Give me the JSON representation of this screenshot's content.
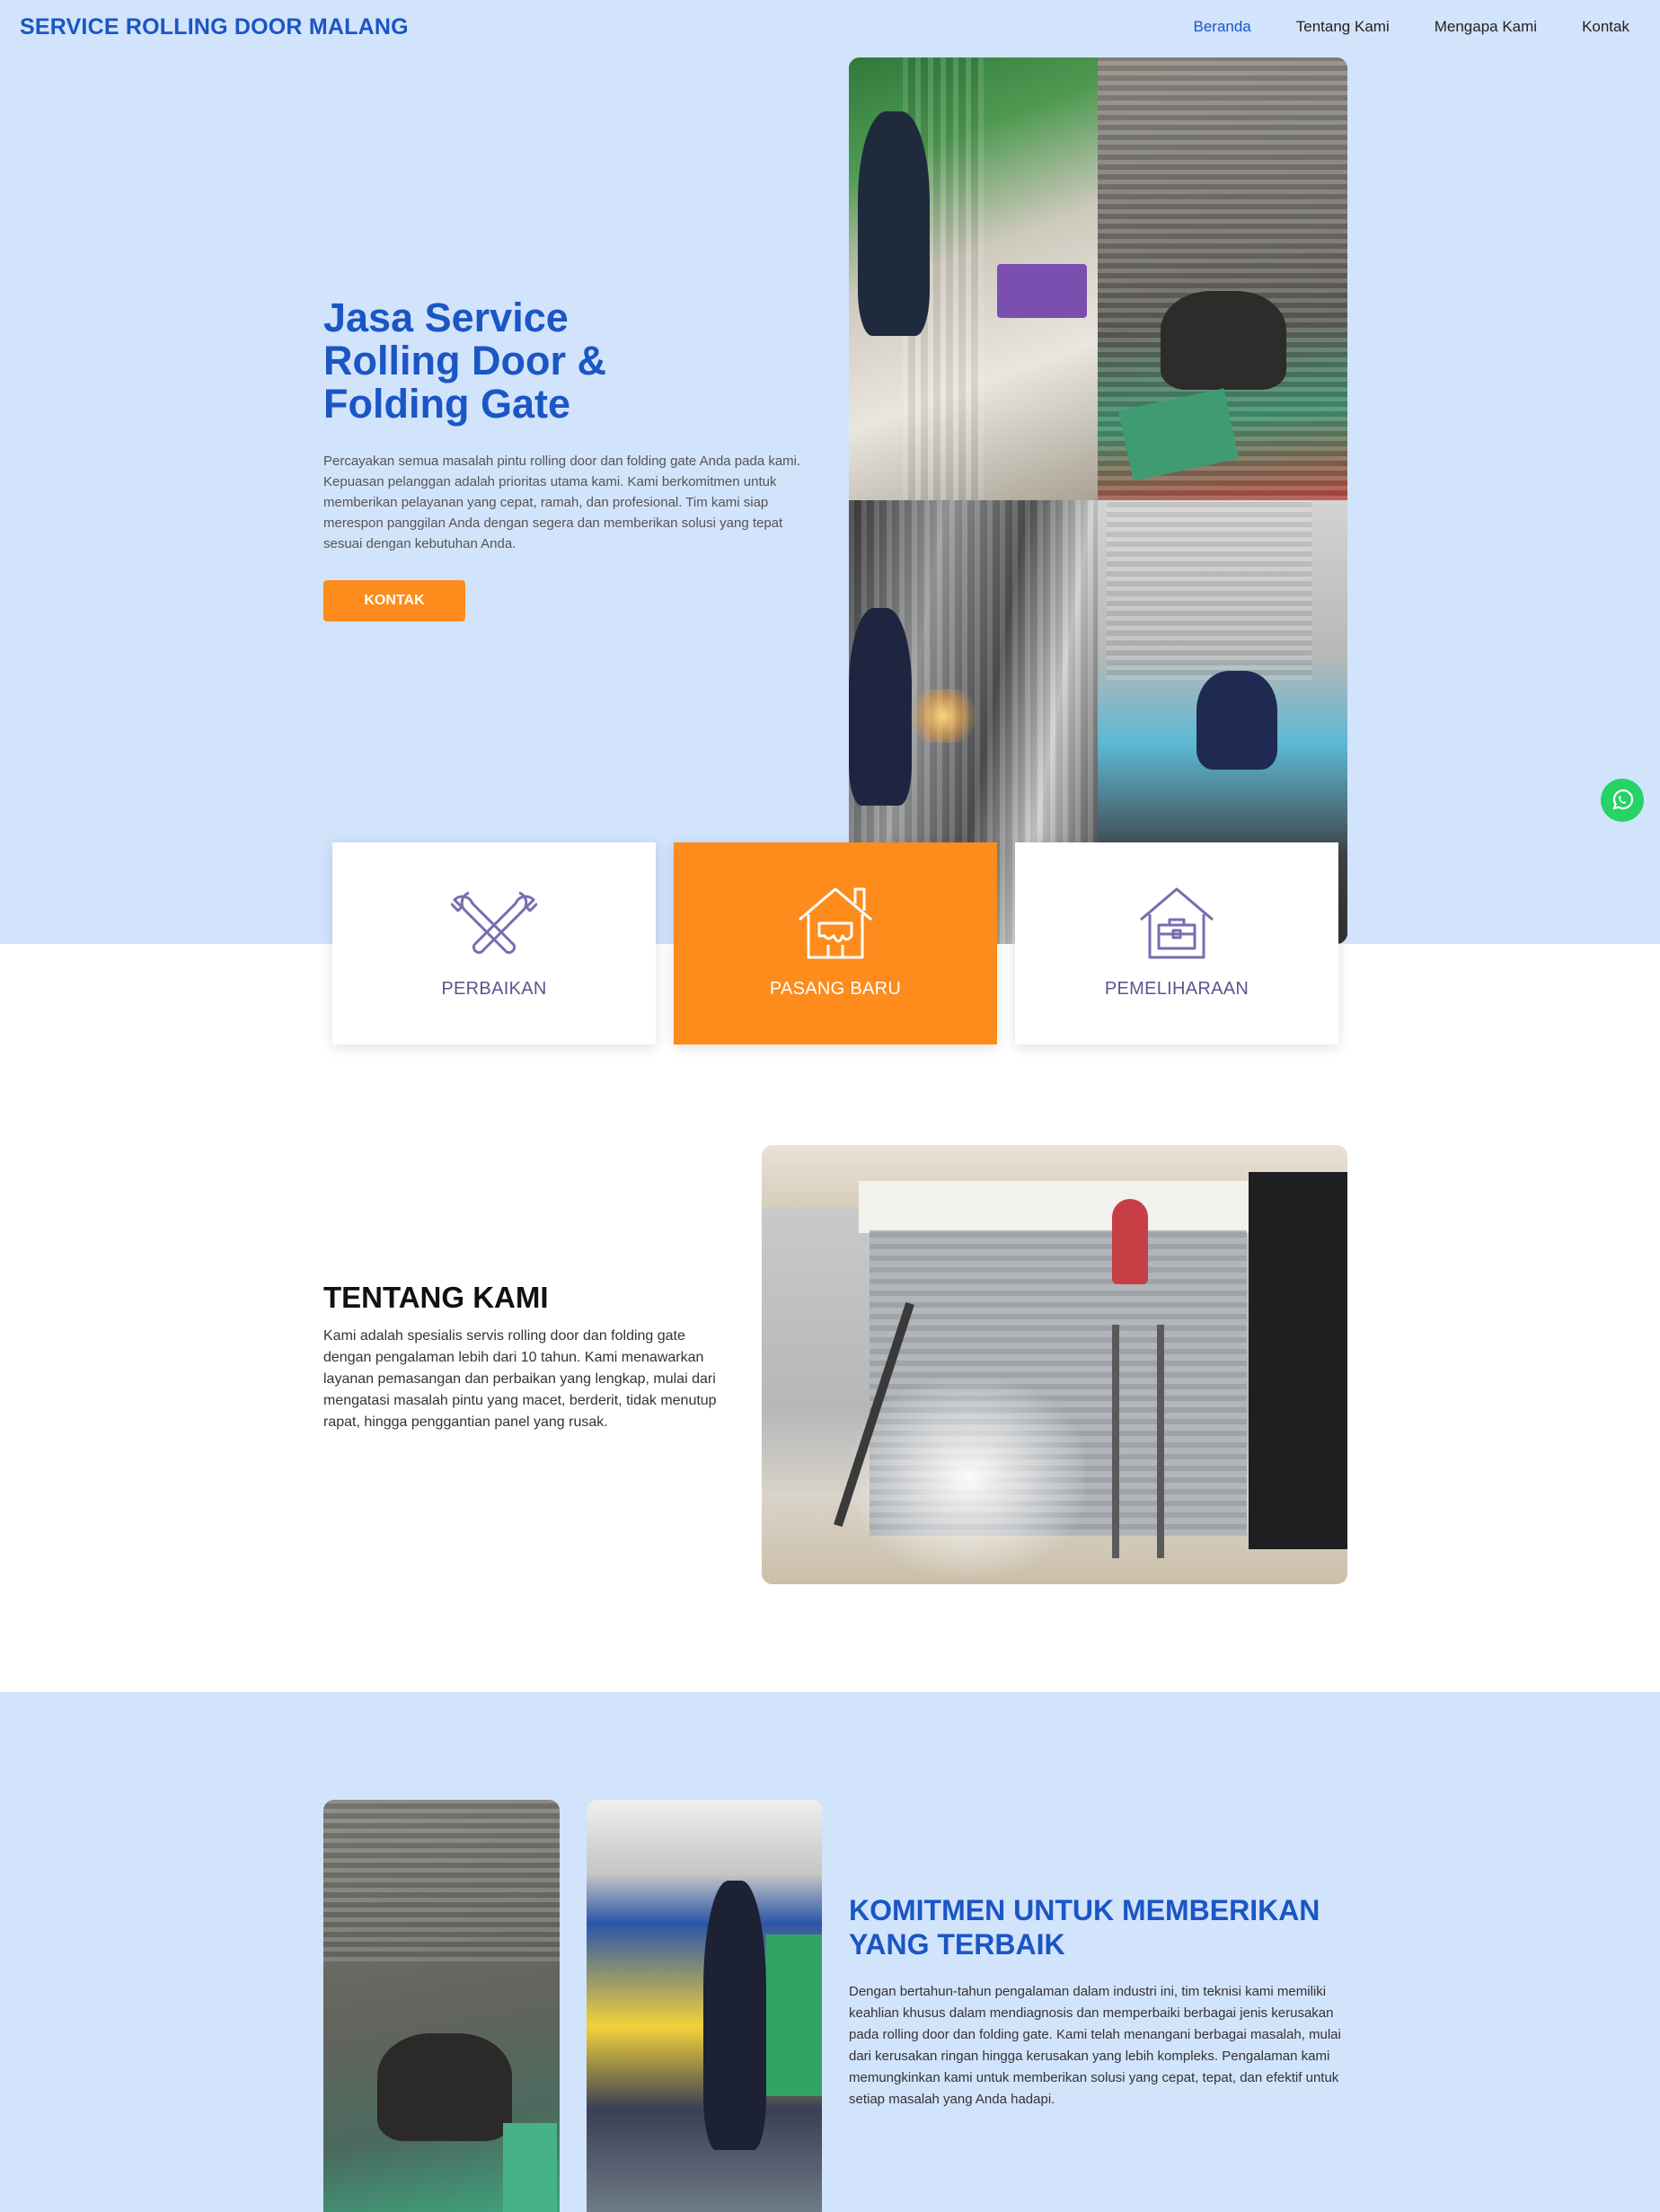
{
  "header": {
    "brand": "SERVICE ROLLING DOOR MALANG",
    "nav": [
      "Beranda",
      "Tentang Kami",
      "Mengapa Kami",
      "Kontak"
    ]
  },
  "hero": {
    "title": "Jasa Service Rolling Door & Folding Gate",
    "text": "Percayakan semua masalah pintu rolling door dan folding gate Anda pada kami. Kepuasan pelanggan adalah prioritas utama kami. Kami berkomitmen untuk memberikan pelayanan yang cepat, ramah, dan profesional. Tim kami siap merespon panggilan Anda dengan segera dan memberikan solusi yang tepat sesuai dengan kebutuhan Anda.",
    "button": "KONTAK"
  },
  "services": [
    {
      "label": "PERBAIKAN",
      "icon": "tools-icon"
    },
    {
      "label": "PASANG BARU",
      "icon": "house-paint-icon"
    },
    {
      "label": "PEMELIHARAAN",
      "icon": "house-toolbox-icon"
    }
  ],
  "about": {
    "title": "TENTANG KAMI",
    "text": "Kami adalah spesialis servis rolling door dan folding gate dengan pengalaman lebih dari 10 tahun. Kami menawarkan layanan pemasangan dan perbaikan yang lengkap, mulai dari mengatasi masalah pintu yang macet, berderit, tidak menutup rapat, hingga penggantian panel yang rusak."
  },
  "commitment": {
    "title": "KOMITMEN UNTUK MEMBERIKAN YANG TERBAIK",
    "text": "Dengan bertahun-tahun pengalaman dalam industri ini, tim teknisi kami memiliki keahlian khusus dalam mendiagnosis dan memperbaiki berbagai jenis kerusakan pada rolling door dan folding gate. Kami telah menangani berbagai masalah, mulai dari kerusakan ringan hingga kerusakan yang lebih kompleks. Pengalaman kami memungkinkan kami untuk memberikan solusi yang cepat, tepat, dan efektif untuk setiap masalah yang Anda hadapi."
  },
  "colors": {
    "brand_blue": "#1a56c4",
    "light_blue_bg": "#d2e3fc",
    "orange": "#fd8c1d",
    "icon_purple": "#5a5690",
    "whatsapp_green": "#25d366"
  }
}
